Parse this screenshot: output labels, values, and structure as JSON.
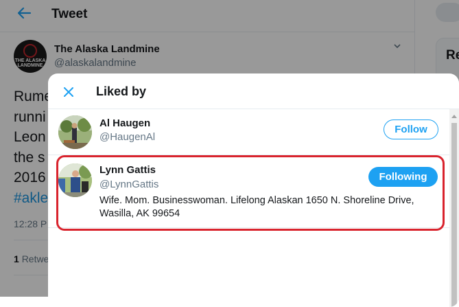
{
  "page": {
    "header_title": "Tweet",
    "sidebar_partial_heading": "Re"
  },
  "tweet": {
    "author_name": "The Alaska Landmine",
    "author_handle": "@alaskalandmine",
    "avatar_text": "THE ALASKA LANDMINE",
    "body_lines": [
      "Rume",
      "runni",
      "Leon",
      "the s",
      "2016"
    ],
    "hashtag_fragment": "#akle",
    "time_fragment": "12:28 P",
    "retweet_count": "1",
    "retweet_label": "Retwe"
  },
  "modal": {
    "title": "Liked by",
    "users": [
      {
        "name": "Al Haugen",
        "handle": "@HaugenAl",
        "button": "Follow",
        "bio": ""
      },
      {
        "name": "Lynn Gattis",
        "handle": "@LynnGattis",
        "button": "Following",
        "bio": "Wife. Mom. Businesswoman. Lifelong Alaskan 1650 N. Shoreline Drive, Wasilla, AK 99654"
      }
    ]
  },
  "colors": {
    "accent": "#1da1f2",
    "highlight": "#d9232d",
    "secondary_text": "#657786"
  },
  "icons": {
    "back": "back-arrow-icon",
    "close": "close-icon",
    "more": "chevron-down-icon"
  }
}
